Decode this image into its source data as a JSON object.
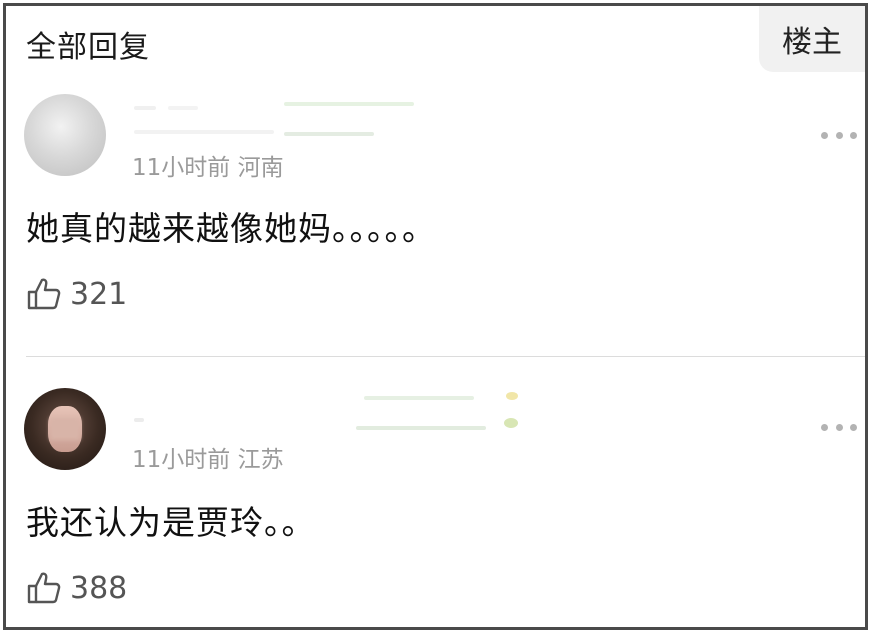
{
  "header": {
    "title": "全部回复",
    "op_label": "楼主"
  },
  "comments": [
    {
      "time": "11小时前",
      "location": "河南",
      "text": "她真的越来越像她妈。。。。。",
      "likes": "321"
    },
    {
      "time": "11小时前",
      "location": "江苏",
      "text": "我还认为是贾玲。。",
      "likes": "388"
    }
  ],
  "icons": {
    "like": "thumbs-up-icon",
    "more": "more-dots-icon"
  },
  "colors": {
    "meta_text": "#9a9a9a",
    "divider": "#dcdcdc",
    "op_bg": "#f1f1f1"
  }
}
